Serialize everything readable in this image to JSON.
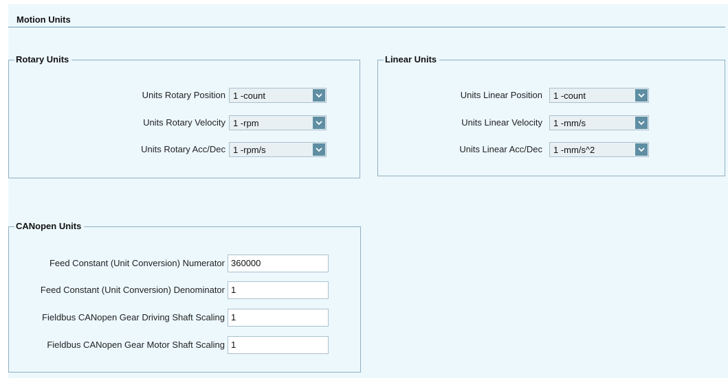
{
  "page": {
    "title": "Motion Units"
  },
  "rotary": {
    "legend": "Rotary Units",
    "rows": [
      {
        "label": "Units Rotary Position",
        "value": "1  -count"
      },
      {
        "label": "Units Rotary Velocity",
        "value": "1  -rpm"
      },
      {
        "label": "Units Rotary Acc/Dec",
        "value": "1  -rpm/s"
      }
    ]
  },
  "linear": {
    "legend": "Linear Units",
    "rows": [
      {
        "label": "Units Linear Position",
        "value": "1  -count"
      },
      {
        "label": "Units Linear Velocity",
        "value": "1  -mm/s"
      },
      {
        "label": "Units Linear Acc/Dec",
        "value": "1  -mm/s^2"
      }
    ]
  },
  "canopen": {
    "legend": "CANopen Units",
    "rows": [
      {
        "label": "Feed Constant (Unit Conversion) Numerator",
        "value": "360000"
      },
      {
        "label": "Feed Constant (Unit Conversion) Denominator",
        "value": "1"
      },
      {
        "label": "Fieldbus CANopen Gear Driving Shaft Scaling",
        "value": "1"
      },
      {
        "label": "Fieldbus CANopen Gear Motor Shaft Scaling",
        "value": "1"
      }
    ]
  },
  "icons": {
    "dropdown": "chevron-down-icon"
  },
  "colors": {
    "panel_background": "#edf8fd",
    "dropdown_button": "#5f8ea3",
    "group_border": "#8fb0c0"
  }
}
